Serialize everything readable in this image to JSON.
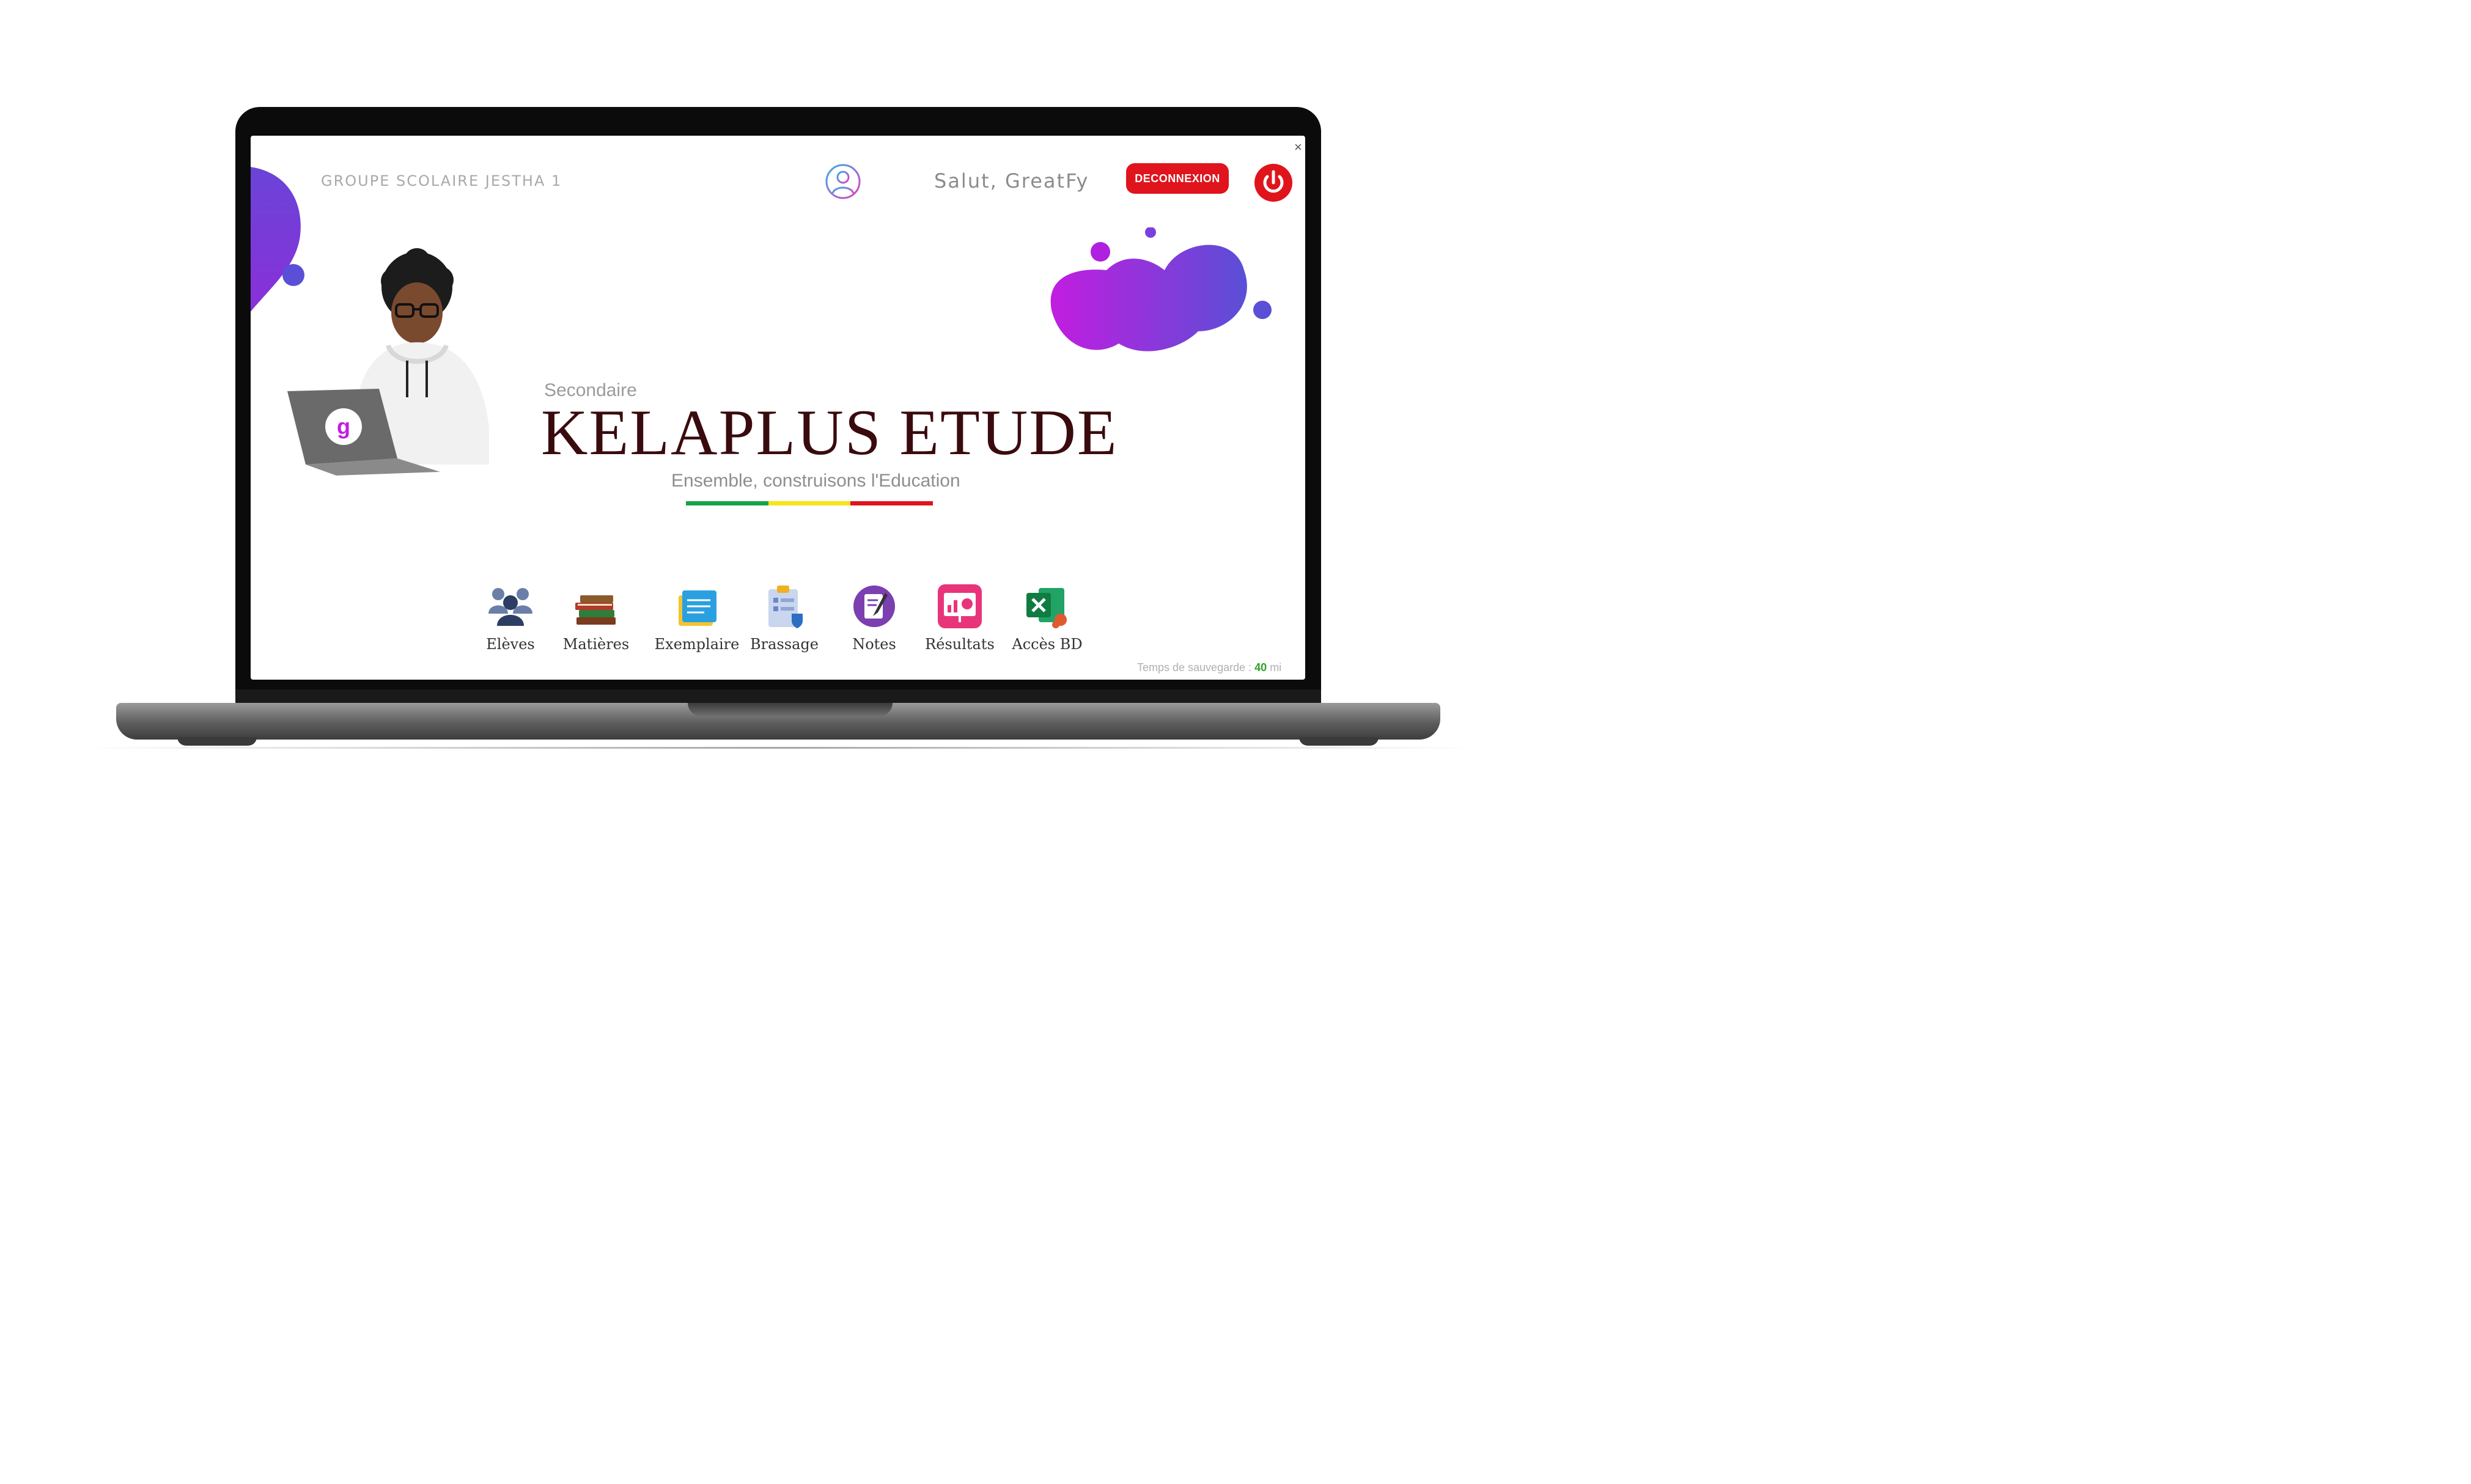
{
  "header": {
    "organization": "GROUPE SCOLAIRE  JESTHA 1",
    "greeting": "Salut, GreatFy",
    "logout_label": "DECONNEXION"
  },
  "hero": {
    "subtitle": "Secondaire",
    "title": "KELAPLUS  ETUDE",
    "slogan": "Ensemble, construisons l'Education",
    "laptop_logo": "g",
    "stripe_colors": [
      "#17a34a",
      "#f5e61a",
      "#e0141c"
    ]
  },
  "toolbar": {
    "items": [
      {
        "label": "Elèves",
        "icon": "students-icon"
      },
      {
        "label": "Matières",
        "icon": "books-icon"
      },
      {
        "label": "Exemplaire",
        "icon": "notepad-icon"
      },
      {
        "label": "Brassage",
        "icon": "clipboard-icon"
      },
      {
        "label": "Notes",
        "icon": "notes-icon"
      },
      {
        "label": "Résultats",
        "icon": "results-icon"
      },
      {
        "label": "Accès BD",
        "icon": "excel-icon"
      }
    ]
  },
  "footer": {
    "save_label": "Temps de sauvegarde :",
    "save_value": "40",
    "save_unit": "mi"
  },
  "colors": {
    "accent_red": "#e0141c",
    "title": "#3a0b0e",
    "blob_from": "#c21de0",
    "blob_to": "#5a4fd6"
  }
}
